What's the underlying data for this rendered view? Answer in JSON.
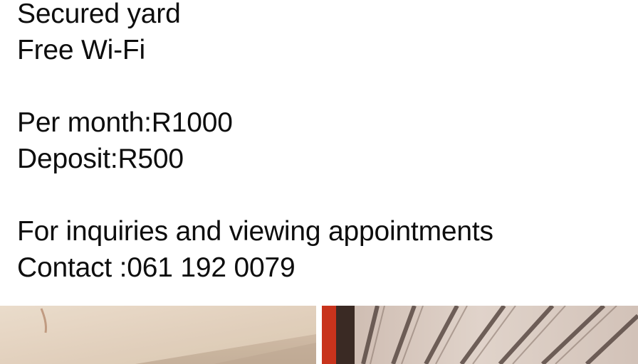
{
  "post": {
    "lines": [
      "Secured yard",
      "Free Wi-Fi",
      "Per month:R1000",
      "Deposit:R500",
      "For inquiries and viewing appointments",
      "Contact :061 192 0079"
    ]
  },
  "photos": [
    {
      "icon": "room-wall-photo"
    },
    {
      "icon": "ceiling-photo"
    }
  ],
  "colors": {
    "text": "#0d0d0d",
    "background": "#ffffff"
  }
}
